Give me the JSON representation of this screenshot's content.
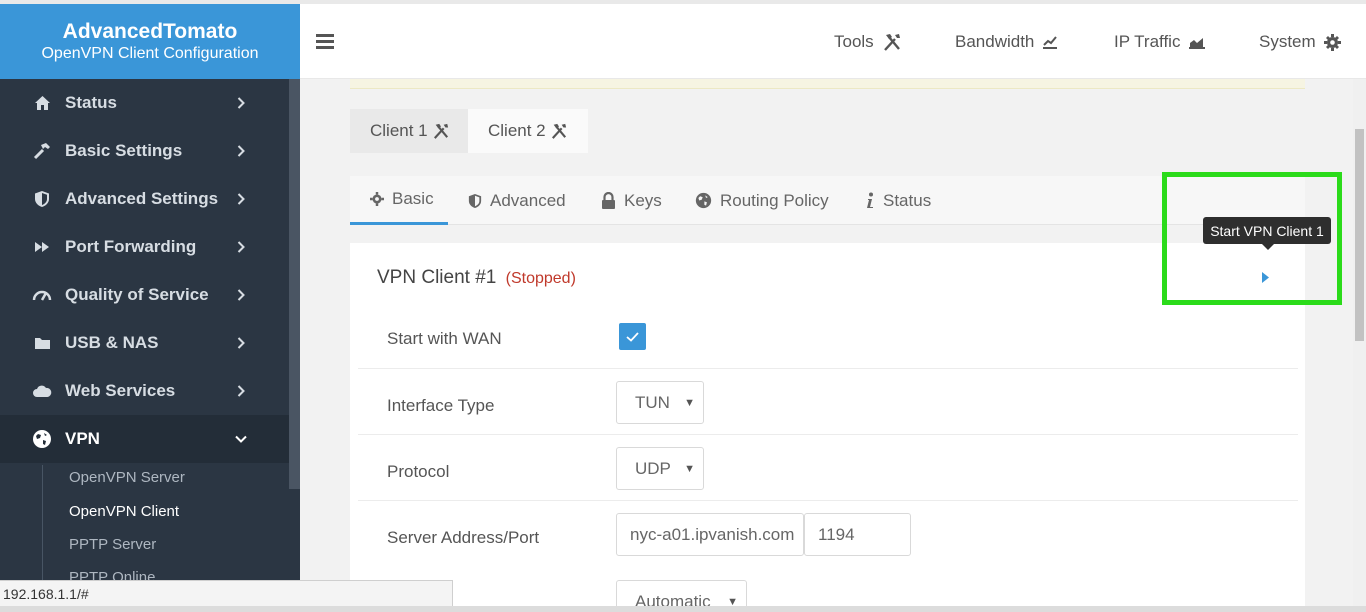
{
  "brand": {
    "title": "AdvancedTomato",
    "subtitle": "OpenVPN Client Configuration"
  },
  "sidebar": {
    "items": [
      {
        "label": "Status",
        "icon": "home-icon"
      },
      {
        "label": "Basic Settings",
        "icon": "hammer-icon"
      },
      {
        "label": "Advanced Settings",
        "icon": "shield-icon"
      },
      {
        "label": "Port Forwarding",
        "icon": "forward-icon"
      },
      {
        "label": "Quality of Service",
        "icon": "gauge-icon"
      },
      {
        "label": "USB & NAS",
        "icon": "folder-icon"
      },
      {
        "label": "Web Services",
        "icon": "cloud-icon"
      },
      {
        "label": "VPN",
        "icon": "globe-icon"
      }
    ],
    "vpn_sub": [
      "OpenVPN Server",
      "OpenVPN Client",
      "PPTP Server",
      "PPTP Online"
    ]
  },
  "header": {
    "links": [
      {
        "label": "Tools",
        "icon": "tools-icon"
      },
      {
        "label": "Bandwidth",
        "icon": "line-chart-icon"
      },
      {
        "label": "IP Traffic",
        "icon": "area-chart-icon"
      },
      {
        "label": "System",
        "icon": "gear-icon"
      }
    ]
  },
  "client_tabs": [
    {
      "label": "Client 1"
    },
    {
      "label": "Client 2"
    }
  ],
  "sub_tabs": [
    {
      "label": "Basic",
      "icon": "gear-icon"
    },
    {
      "label": "Advanced",
      "icon": "shield-icon"
    },
    {
      "label": "Keys",
      "icon": "lock-icon"
    },
    {
      "label": "Routing Policy",
      "icon": "globe-icon"
    },
    {
      "label": "Status",
      "icon": "info-icon"
    }
  ],
  "panel": {
    "title": "VPN Client #1",
    "status": "(Stopped)",
    "tooltip": "Start VPN Client 1",
    "rows": {
      "start_with_wan": {
        "label": "Start with WAN",
        "checked": true
      },
      "interface_type": {
        "label": "Interface Type",
        "value": "TUN"
      },
      "protocol": {
        "label": "Protocol",
        "value": "UDP"
      },
      "server": {
        "label": "Server Address/Port",
        "address": "nyc-a01.ipvanish.com",
        "port": "1194"
      },
      "next": {
        "value": "Automatic"
      }
    }
  },
  "statusbar": {
    "url": "192.168.1.1/#"
  },
  "colors": {
    "accent": "#3a96d8",
    "sidebar": "#2b3643",
    "highlight": "#2bdb1a",
    "stopped": "#c0392b"
  }
}
